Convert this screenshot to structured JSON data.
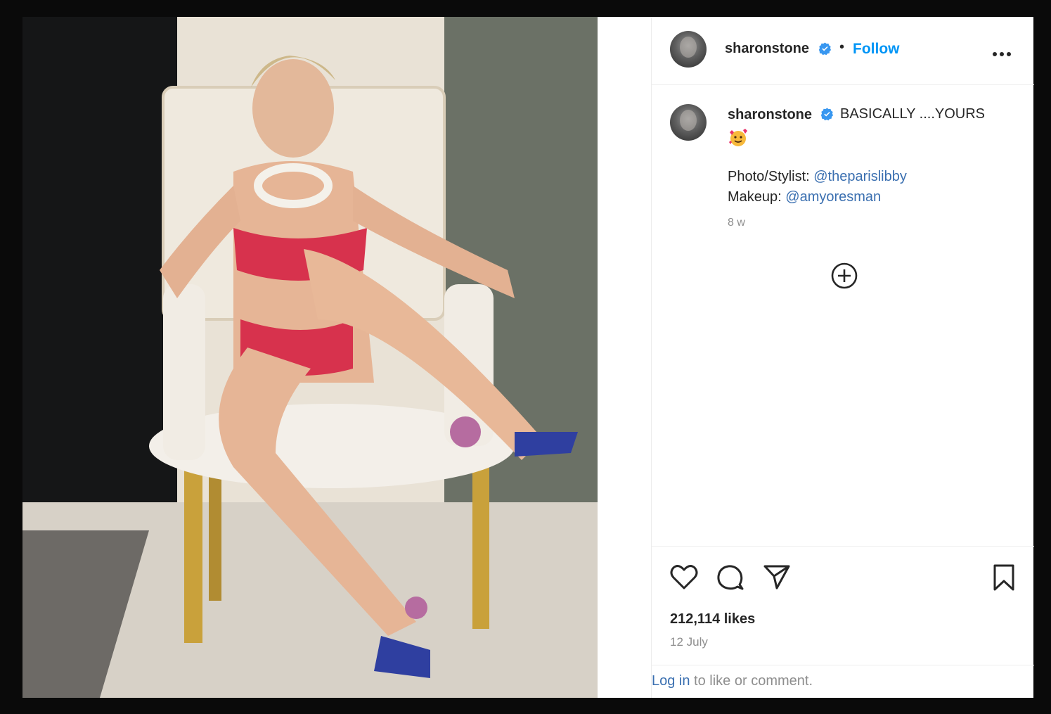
{
  "post": {
    "username": "sharonstone",
    "separator": "•",
    "follow_label": "Follow",
    "caption": {
      "username": "sharonstone",
      "text": "BASICALLY ....YOURS",
      "credit1_label": "Photo/Stylist: ",
      "credit1_mention": "@theparislibby",
      "credit2_label": "Makeup: ",
      "credit2_mention": "@amyoresman",
      "time": "8 w"
    },
    "likes": "212,114 likes",
    "date": "12 July",
    "login_link": "Log in",
    "login_rest": " to like or comment."
  },
  "colors": {
    "accent": "#0095f6",
    "verified": "#3897f0",
    "text": "#262626",
    "muted": "#8e8e8e"
  },
  "icons": [
    "more-icon",
    "verified-icon",
    "add-comments-icon",
    "heart-icon",
    "comment-icon",
    "share-icon",
    "bookmark-icon",
    "smiling-face-with-hearts-emoji"
  ]
}
